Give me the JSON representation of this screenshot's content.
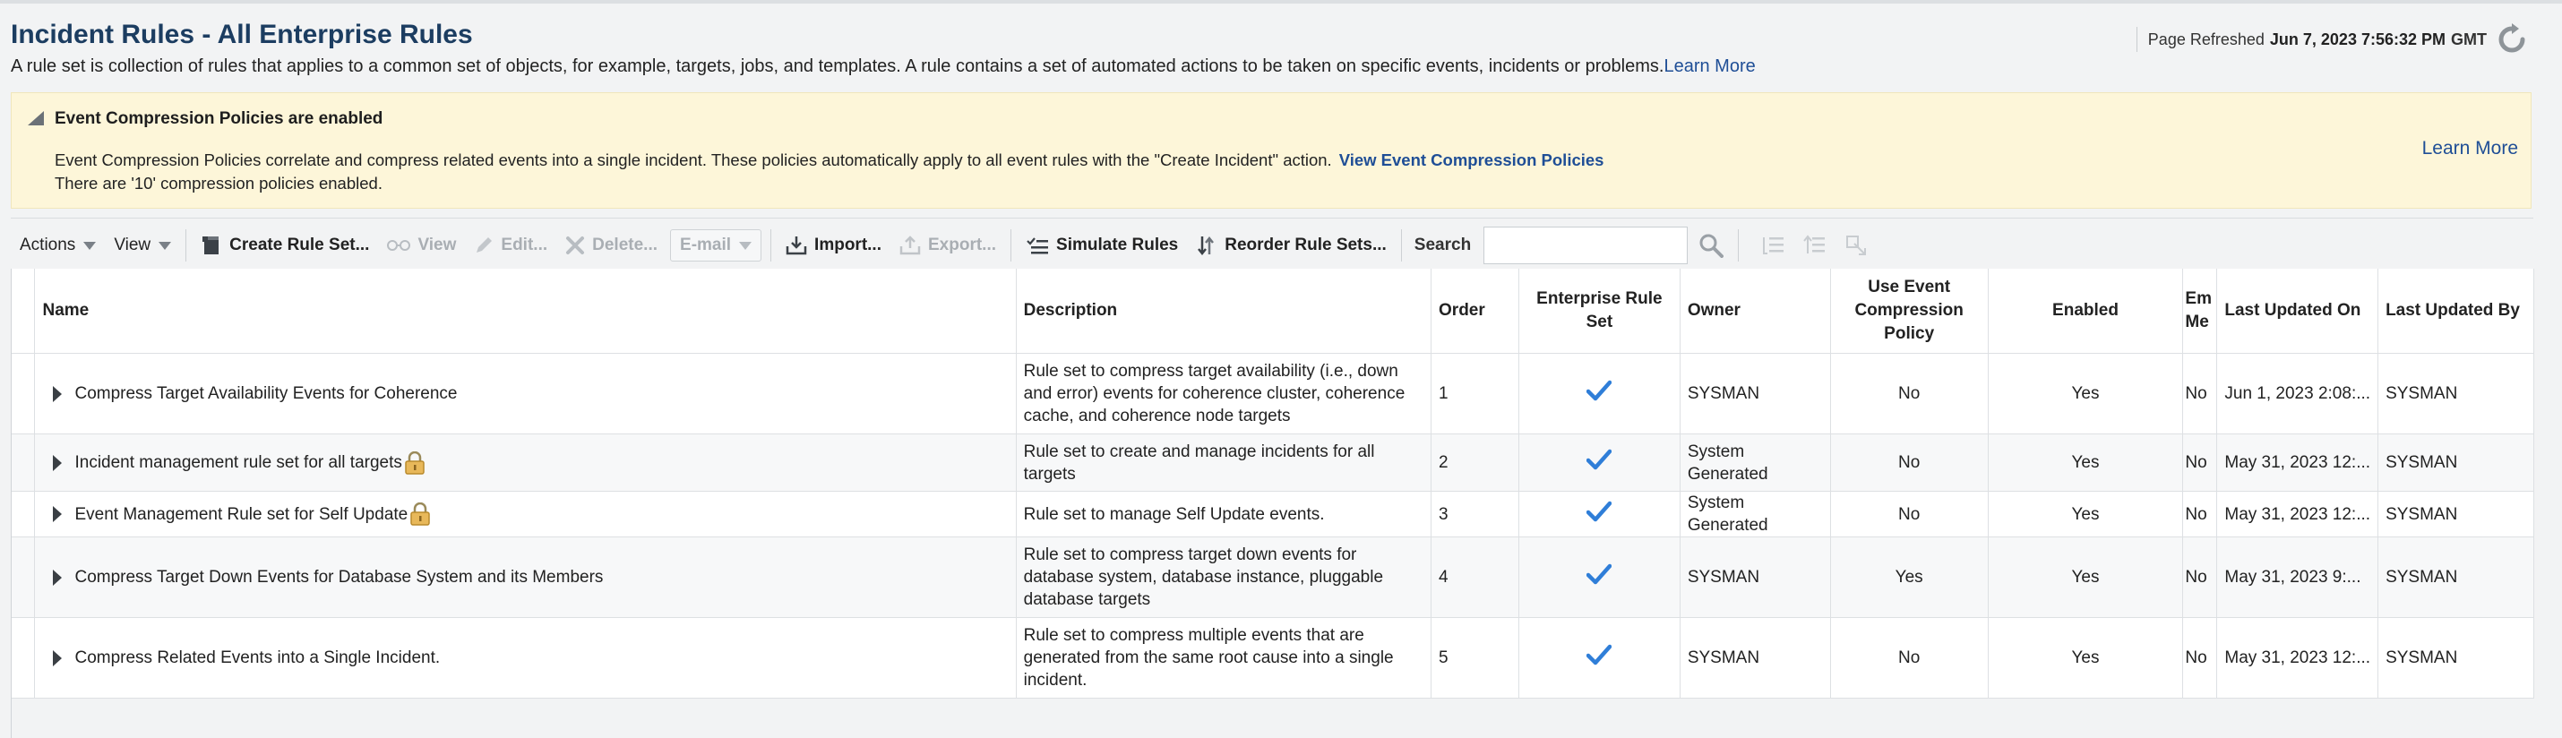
{
  "header": {
    "title": "Incident Rules - All Enterprise Rules",
    "description": "A rule set is collection of rules that applies to a common set of objects, for example, targets, jobs, and templates. A rule contains a set of automated actions to be taken on specific events, incidents or problems.",
    "learn_more": "Learn More",
    "refresh_label": "Page Refreshed",
    "refresh_time": "Jun 7, 2023 7:56:32 PM",
    "refresh_tz": "GMT"
  },
  "banner": {
    "title": "Event Compression Policies are enabled",
    "description": "Event Compression Policies correlate and compress related events into a single incident. These policies automatically apply to all event rules with the \"Create Incident\" action.",
    "link": "View Event Compression Policies",
    "count_text": "There are '10' compression policies enabled.",
    "learn_more": "Learn More",
    "bg_color": "#fdf6d9"
  },
  "toolbar": {
    "actions": "Actions",
    "view_menu": "View",
    "create": "Create Rule Set...",
    "view": "View",
    "edit": "Edit...",
    "delete": "Delete...",
    "email": "E-mail",
    "import": "Import...",
    "export": "Export...",
    "simulate": "Simulate Rules",
    "reorder": "Reorder Rule Sets...",
    "search_label": "Search",
    "search_value": ""
  },
  "table": {
    "columns": {
      "name": "Name",
      "description": "Description",
      "order": "Order",
      "enterprise": "Enterprise Rule Set",
      "owner": "Owner",
      "compression": "Use Event Compression Policy",
      "enabled": "Enabled",
      "em": "Em Me",
      "updated_on": "Last Updated On",
      "updated_by": "Last Updated By"
    },
    "rows": [
      {
        "name": "Compress Target Availability Events for Coherence",
        "locked": false,
        "description": "Rule set to compress target availability (i.e., down and error) events for coherence cluster, coherence cache, and coherence node targets",
        "order": "1",
        "enterprise": true,
        "owner": "SYSMAN",
        "compression": "No",
        "enabled": "Yes",
        "em": "No",
        "updated_on": "Jun 1, 2023 2:08:...",
        "updated_by": "SYSMAN"
      },
      {
        "name": "Incident management rule set for all targets",
        "locked": true,
        "description": "Rule set to create and manage incidents for all targets",
        "order": "2",
        "enterprise": true,
        "owner": "System Generated",
        "compression": "No",
        "enabled": "Yes",
        "em": "No",
        "updated_on": "May 31, 2023 12:...",
        "updated_by": "SYSMAN"
      },
      {
        "name": "Event Management Rule set for Self Update",
        "locked": true,
        "description": "Rule set to manage Self Update events.",
        "order": "3",
        "enterprise": true,
        "owner": "System Generated",
        "compression": "No",
        "enabled": "Yes",
        "em": "No",
        "updated_on": "May 31, 2023 12:...",
        "updated_by": "SYSMAN"
      },
      {
        "name": "Compress Target Down Events for Database System and its Members",
        "locked": false,
        "description": "Rule set to compress target down events for database system, database instance, pluggable database targets",
        "order": "4",
        "enterprise": true,
        "owner": "SYSMAN",
        "compression": "Yes",
        "enabled": "Yes",
        "em": "No",
        "updated_on": "May 31, 2023 9:...",
        "updated_by": "SYSMAN"
      },
      {
        "name": "Compress Related Events into a Single Incident.",
        "locked": false,
        "description": "Rule set to compress multiple events that are generated from the same root cause into a single incident.",
        "order": "5",
        "enterprise": true,
        "owner": "SYSMAN",
        "compression": "No",
        "enabled": "Yes",
        "em": "No",
        "updated_on": "May 31, 2023 12:...",
        "updated_by": "SYSMAN"
      }
    ],
    "check_color": "#2f7ed8"
  }
}
